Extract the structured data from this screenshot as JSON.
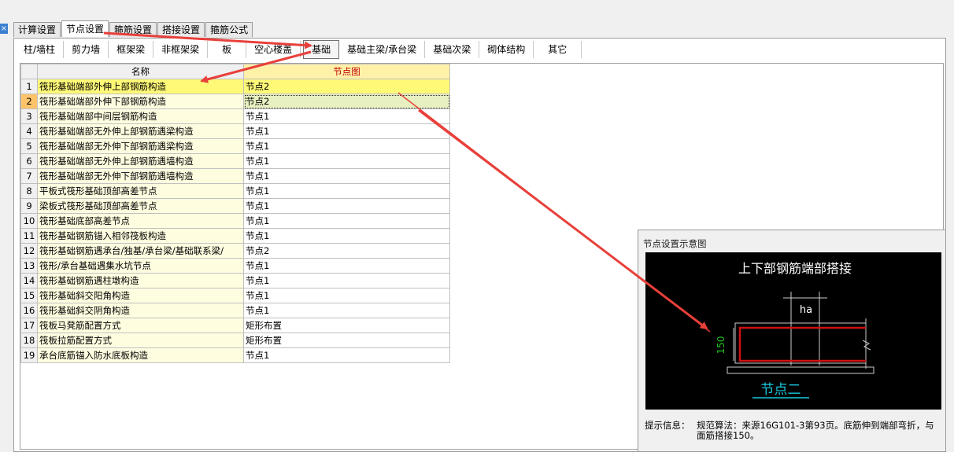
{
  "window": {
    "close_glyph": "×"
  },
  "tabs": [
    "计算设置",
    "节点设置",
    "箍筋设置",
    "搭接设置",
    "箍筋公式"
  ],
  "subtabs": [
    "柱/墙柱",
    "剪力墙",
    "框架梁",
    "非框架梁",
    "板",
    "空心楼盖",
    "基础",
    "基础主梁/承台梁",
    "基础次梁",
    "砌体结构",
    "其它"
  ],
  "grid": {
    "headers": [
      "名称",
      "节点图"
    ],
    "rows": [
      {
        "no": "1",
        "name": "筏形基础端部外伸上部钢筋构造",
        "value": "节点2"
      },
      {
        "no": "2",
        "name": "筏形基础端部外伸下部钢筋构造",
        "value": "节点2"
      },
      {
        "no": "3",
        "name": "筏形基础端部中间层钢筋构造",
        "value": "节点1"
      },
      {
        "no": "4",
        "name": "筏形基础端部无外伸上部钢筋遇梁构造",
        "value": "节点1"
      },
      {
        "no": "5",
        "name": "筏形基础端部无外伸下部钢筋遇梁构造",
        "value": "节点1"
      },
      {
        "no": "6",
        "name": "筏形基础端部无外伸上部钢筋遇墙构造",
        "value": "节点1"
      },
      {
        "no": "7",
        "name": "筏形基础端部无外伸下部钢筋遇墙构造",
        "value": "节点1"
      },
      {
        "no": "8",
        "name": "平板式筏形基础顶部高差节点",
        "value": "节点1"
      },
      {
        "no": "9",
        "name": "梁板式筏形基础顶部高差节点",
        "value": "节点1"
      },
      {
        "no": "10",
        "name": "筏形基础底部高差节点",
        "value": "节点1"
      },
      {
        "no": "11",
        "name": "筏形基础钢筋锚入相邻筏板构造",
        "value": "节点1"
      },
      {
        "no": "12",
        "name": "筏形基础钢筋遇承台/独基/承台梁/基础联系梁/",
        "value": "节点2"
      },
      {
        "no": "13",
        "name": "筏形/承台基础遇集水坑节点",
        "value": "节点1"
      },
      {
        "no": "14",
        "name": "筏形基础钢筋遇柱墩构造",
        "value": "节点1"
      },
      {
        "no": "15",
        "name": "筏形基础斜交阳角构造",
        "value": "节点1"
      },
      {
        "no": "16",
        "name": "筏形基础斜交阴角构造",
        "value": "节点1"
      },
      {
        "no": "17",
        "name": "筏板马凳筋配置方式",
        "value": "矩形布置"
      },
      {
        "no": "18",
        "name": "筏板拉筋配置方式",
        "value": "矩形布置"
      },
      {
        "no": "19",
        "name": "承台底筋锚入防水底板构造",
        "value": "节点1"
      }
    ]
  },
  "diagram": {
    "panel_title": "节点设置示意图",
    "heading": "上下部钢筋端部搭接",
    "dim_ha": "ha",
    "dim_150": "150",
    "node_label": "节点二",
    "info_label": "提示信息：",
    "info_text": "规范算法：来源16G101-3第93页。底筋伸到端部弯折，与面筋搭接150。"
  },
  "colors": {
    "arrow": "#e8403a",
    "rebar": "#d01010",
    "node_label": "#19c8e0",
    "dim_green": "#22c522",
    "header_red": "#c00000"
  }
}
